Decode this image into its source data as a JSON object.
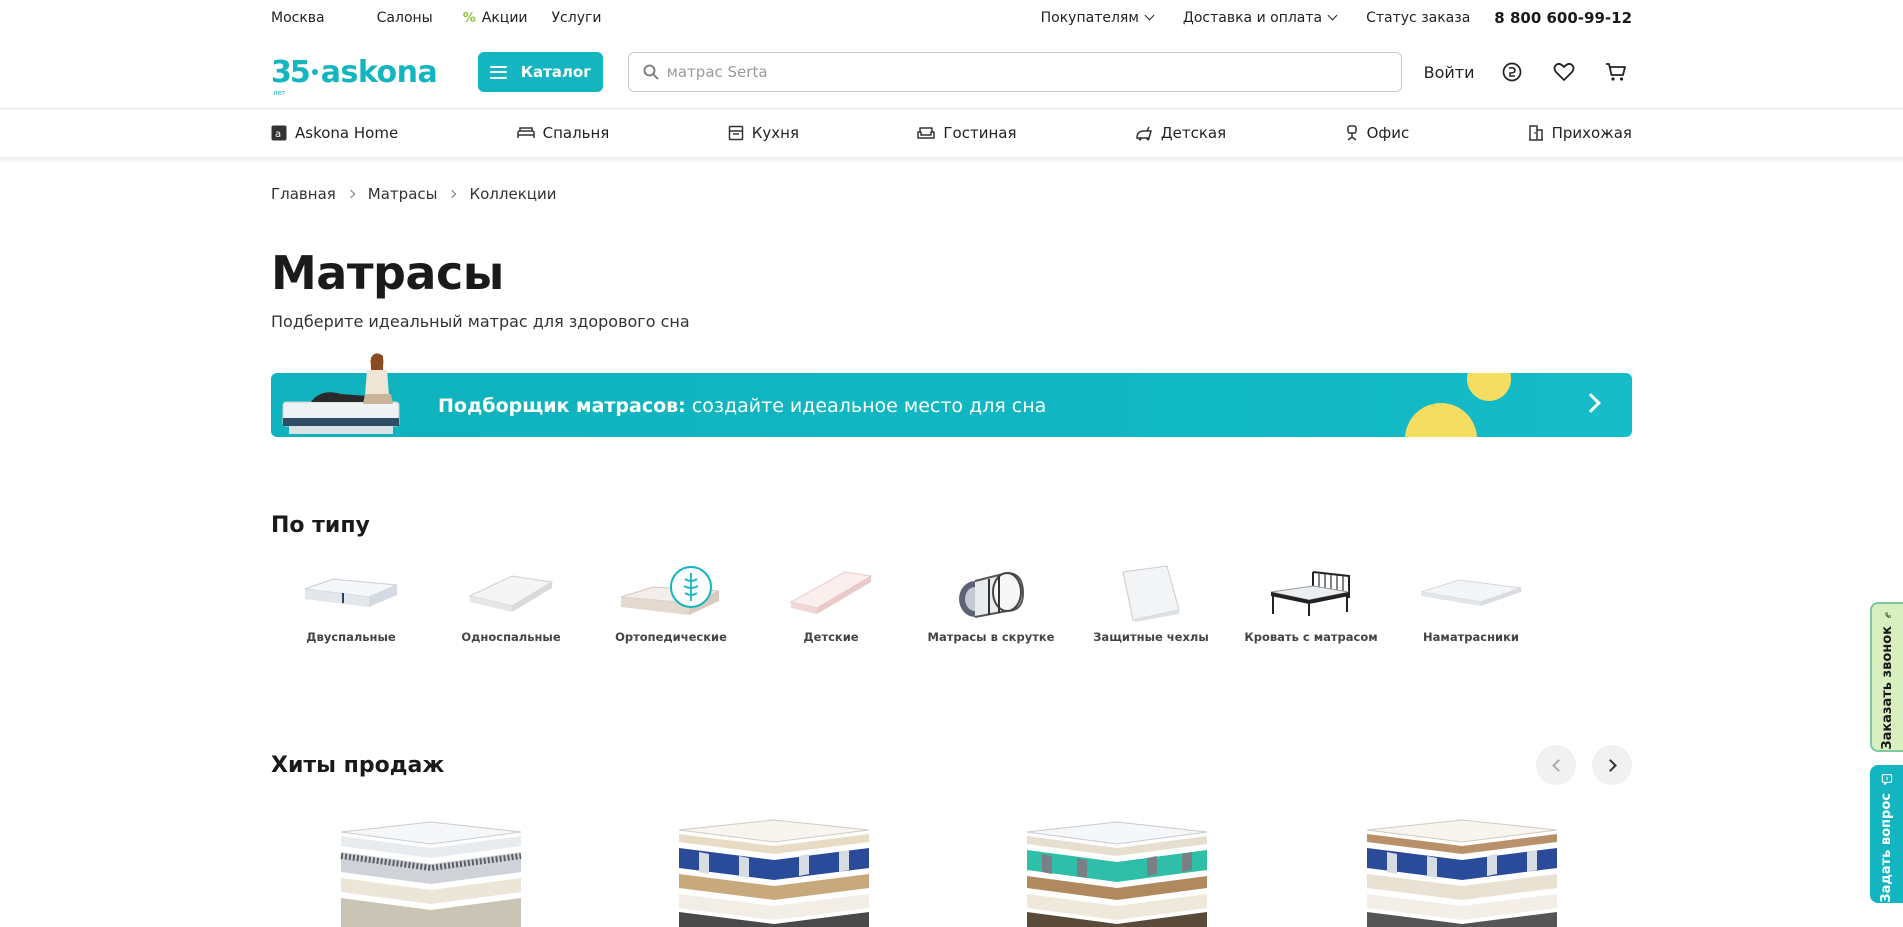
{
  "topbar": {
    "city": "Москва",
    "salons": "Салоны",
    "promos": "Акции",
    "services": "Услуги",
    "buyers": "Покупателям",
    "delivery": "Доставка и оплата",
    "order_status": "Статус заказа",
    "phone": "8 800 600-99-12"
  },
  "header": {
    "logo_years": "35",
    "logo_years_caption": "лет",
    "logo_text": "askona",
    "catalog_label": "Каталог",
    "search_placeholder": "матрас Serta",
    "login_label": "Войти"
  },
  "category_nav": [
    {
      "label": "Askona Home",
      "icon": "askona-home-icon"
    },
    {
      "label": "Спальня",
      "icon": "bed-icon"
    },
    {
      "label": "Кухня",
      "icon": "kitchen-icon"
    },
    {
      "label": "Гостиная",
      "icon": "sofa-icon"
    },
    {
      "label": "Детская",
      "icon": "kids-icon"
    },
    {
      "label": "Офис",
      "icon": "office-chair-icon"
    },
    {
      "label": "Прихожая",
      "icon": "hallway-icon"
    }
  ],
  "breadcrumbs": [
    "Главная",
    "Матрасы",
    "Коллекции"
  ],
  "page": {
    "title": "Матрасы",
    "subtitle": "Подберите идеальный матрас для здорового сна"
  },
  "banner": {
    "bold": "Подборщик матрасов:",
    "text": " создайте идеальное место для сна"
  },
  "types_section": {
    "title": "По типу",
    "items": [
      {
        "label": "Двуспальные"
      },
      {
        "label": "Односпальные"
      },
      {
        "label": "Ортопедические"
      },
      {
        "label": "Детские"
      },
      {
        "label": "Матрасы в скрутке"
      },
      {
        "label": "Защитные чехлы"
      },
      {
        "label": "Кровать с матрасом"
      },
      {
        "label": "Наматрасники"
      }
    ]
  },
  "hits_section": {
    "title": "Хиты продаж"
  },
  "side_widgets": {
    "callback": "Заказать звонок",
    "question": "Задать вопрос"
  },
  "colors": {
    "brand": "#12b5c0",
    "sun": "#f5dd61"
  }
}
